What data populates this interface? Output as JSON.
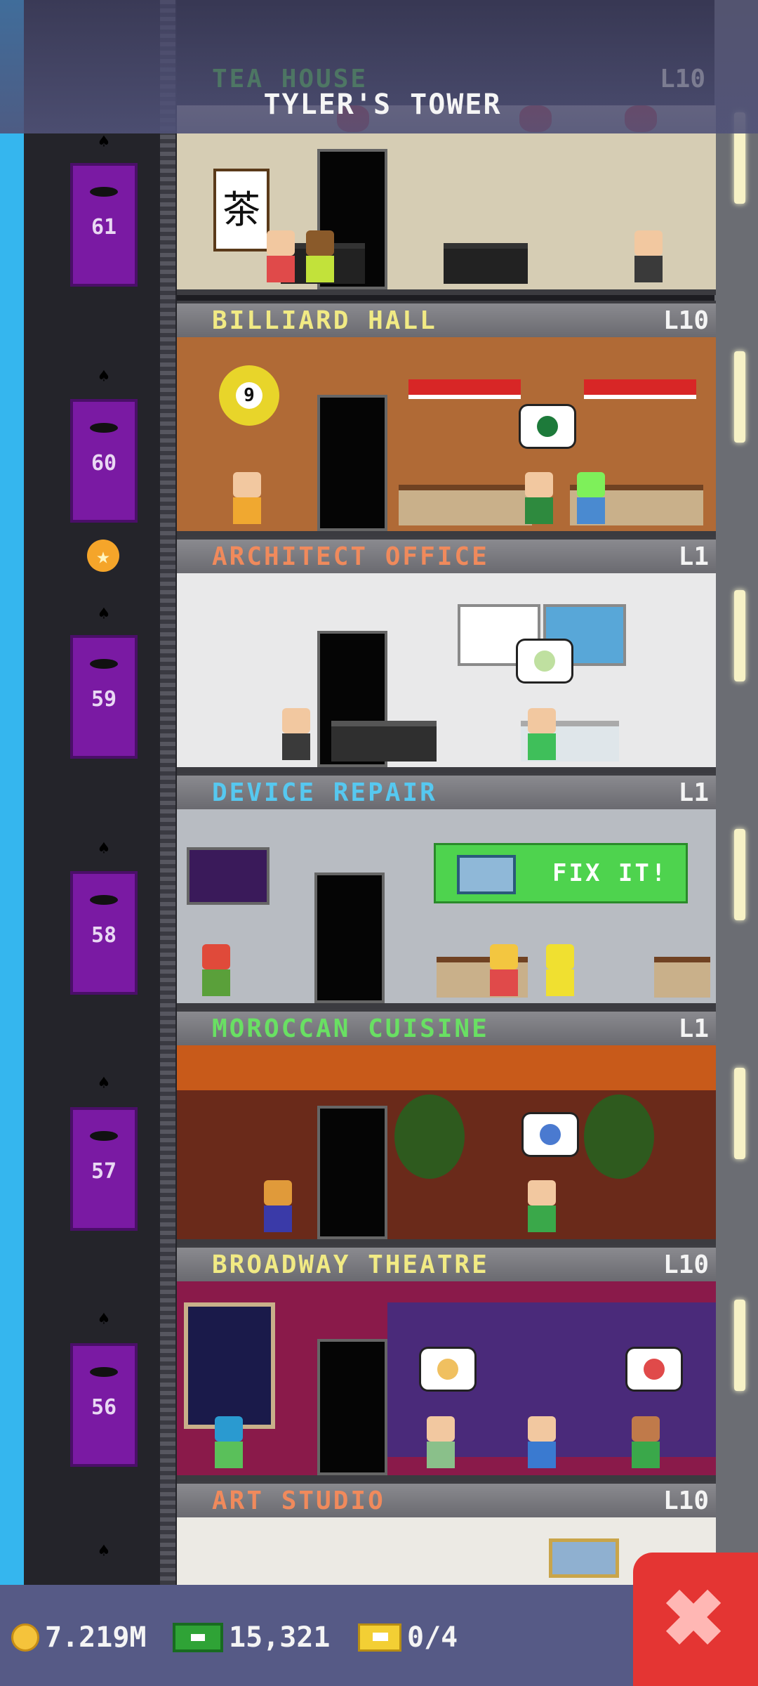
{
  "header": {
    "title": "TYLER'S TOWER",
    "partial_floor_name": "TEA HOUSE",
    "partial_floor_level": "L10"
  },
  "floors": [
    {
      "name": "BILLIARD HALL",
      "level": "L10",
      "name_color": "#f1ea84"
    },
    {
      "name": "ARCHITECT OFFICE",
      "level": "L1",
      "name_color": "#f08a5c"
    },
    {
      "name": "DEVICE REPAIR",
      "level": "L1",
      "name_color": "#56c8f0"
    },
    {
      "name": "MOROCCAN CUISINE",
      "level": "L1",
      "name_color": "#69e063"
    },
    {
      "name": "BROADWAY THEATRE",
      "level": "L10",
      "name_color": "#f1ea84"
    },
    {
      "name": "ART STUDIO",
      "level": "L10",
      "name_color": "#f08a5c"
    }
  ],
  "elevator_floors": [
    "61",
    "60",
    "59",
    "58",
    "57",
    "56"
  ],
  "device_repair": {
    "fix_label": "FIX IT!"
  },
  "currency": {
    "coins": "7.219M",
    "bux": "15,321",
    "tickets": "0/4"
  },
  "icons": {
    "coin": "coin-icon",
    "bux": "bux-icon",
    "ticket": "ticket-icon",
    "close": "close-icon",
    "star": "star-icon",
    "bat": "bat-icon"
  },
  "colors": {
    "elevator": "#7a1aa3",
    "bottom_bar": "#565a86",
    "close_button": "#e43533",
    "sky": "#35b6ee"
  }
}
